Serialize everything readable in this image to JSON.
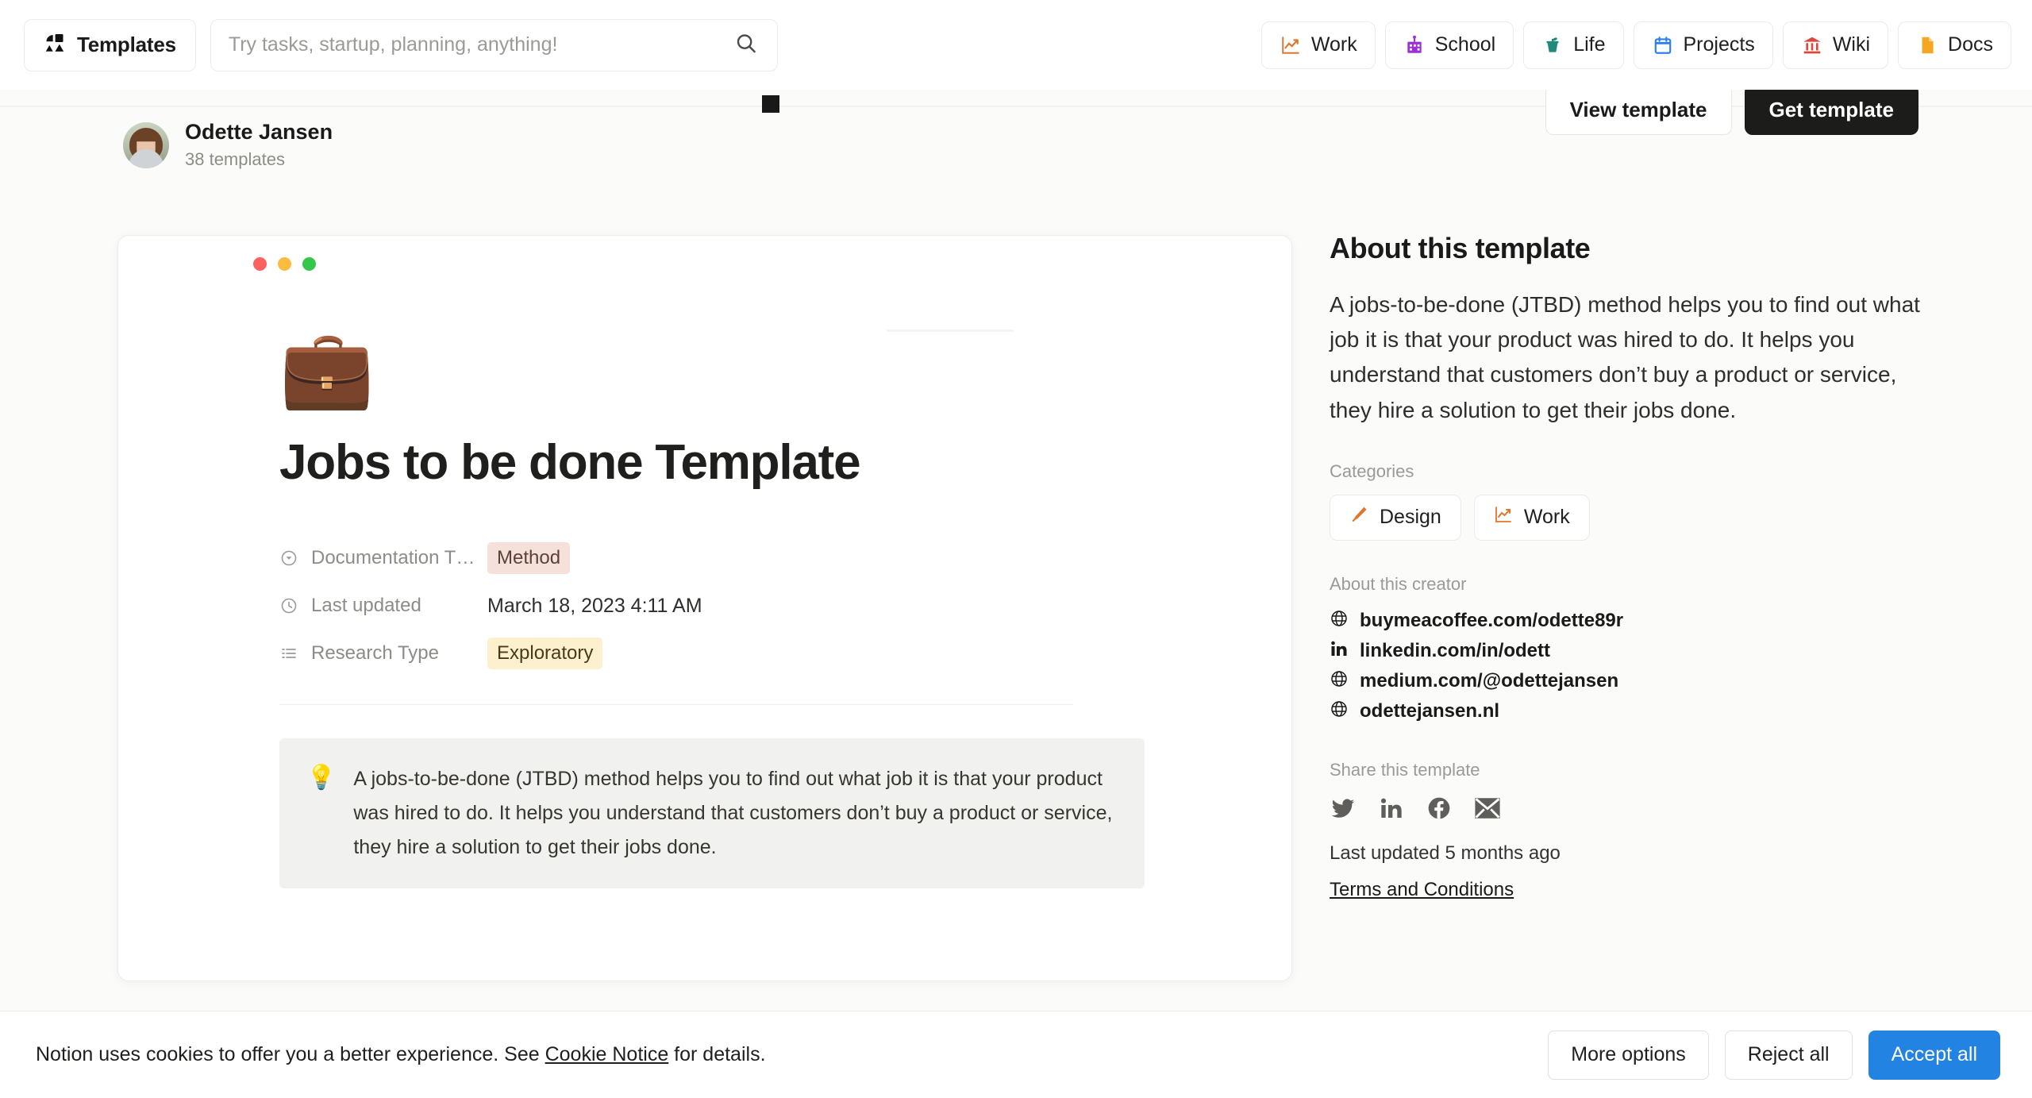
{
  "header": {
    "brand_label": "Templates",
    "brand_icon": "shapes-icon",
    "search": {
      "placeholder": "Try tasks, startup, planning, anything!",
      "value": "",
      "icon": "search-icon"
    },
    "nav": [
      {
        "label": "Work",
        "icon": "chart-up-icon",
        "color": "#e0752d"
      },
      {
        "label": "School",
        "icon": "school-icon",
        "color": "#9b30d9"
      },
      {
        "label": "Life",
        "icon": "drink-icon",
        "color": "#1f8a7a"
      },
      {
        "label": "Projects",
        "icon": "calendar-icon",
        "color": "#2f80ed"
      },
      {
        "label": "Wiki",
        "icon": "bank-icon",
        "color": "#e0453a"
      },
      {
        "label": "Docs",
        "icon": "document-icon",
        "color": "#f5a623"
      }
    ]
  },
  "cta": {
    "view_label": "View template",
    "get_label": "Get template"
  },
  "author": {
    "name": "Odette Jansen",
    "templates_count": "38 templates"
  },
  "preview": {
    "window_dots": [
      "red",
      "yellow",
      "green"
    ],
    "emoji": "💼",
    "title": "Jobs to be done Template",
    "properties": [
      {
        "icon": "select-icon",
        "name": "Documentation T…",
        "value": "Method",
        "value_type": "tag",
        "tag_color": "pink"
      },
      {
        "icon": "clock-icon",
        "name": "Last updated",
        "value": "March 18, 2023 4:11 AM",
        "value_type": "text",
        "tag_color": ""
      },
      {
        "icon": "list-icon",
        "name": "Research Type",
        "value": "Exploratory",
        "value_type": "tag",
        "tag_color": "yellow"
      }
    ],
    "callout": {
      "emoji": "💡",
      "text": "A jobs-to-be-done (JTBD) method helps you to find out what job it is that your product was hired to do. It helps you understand that customers don’t buy a product or service, they hire a solution to get their jobs done."
    }
  },
  "sidebar": {
    "heading": "About this template",
    "description": "A jobs-to-be-done (JTBD) method helps you to find out what job it is that your product was hired to do. It helps you understand that customers don’t buy a product or service, they hire a solution to get their jobs done.",
    "categories_label": "Categories",
    "categories": [
      {
        "label": "Design",
        "icon": "paintbrush-icon",
        "color": "#e0752d"
      },
      {
        "label": "Work",
        "icon": "chart-up-icon",
        "color": "#e0752d"
      }
    ],
    "creator_label": "About this creator",
    "creator_links": [
      {
        "text": "buymeacoffee.com/odette89r",
        "icon": "globe-icon"
      },
      {
        "text": "linkedin.com/in/odett",
        "icon": "linkedin-icon"
      },
      {
        "text": "medium.com/@odettejansen",
        "icon": "globe-icon"
      },
      {
        "text": "odettejansen.nl",
        "icon": "globe-icon"
      }
    ],
    "share_label": "Share this template",
    "share_icons": [
      "twitter-icon",
      "linkedin-icon",
      "facebook-icon",
      "email-icon"
    ],
    "last_updated": "Last updated 5 months ago",
    "terms": "Terms and Conditions"
  },
  "cookie_banner": {
    "text_before": "Notion uses cookies to offer you a better experience. See ",
    "link": "Cookie Notice",
    "text_after": " for details.",
    "buttons": [
      {
        "label": "More options",
        "style": "secondary"
      },
      {
        "label": "Reject all",
        "style": "secondary"
      },
      {
        "label": "Accept all",
        "style": "primary"
      }
    ],
    "accent_color": "#2383e2"
  }
}
